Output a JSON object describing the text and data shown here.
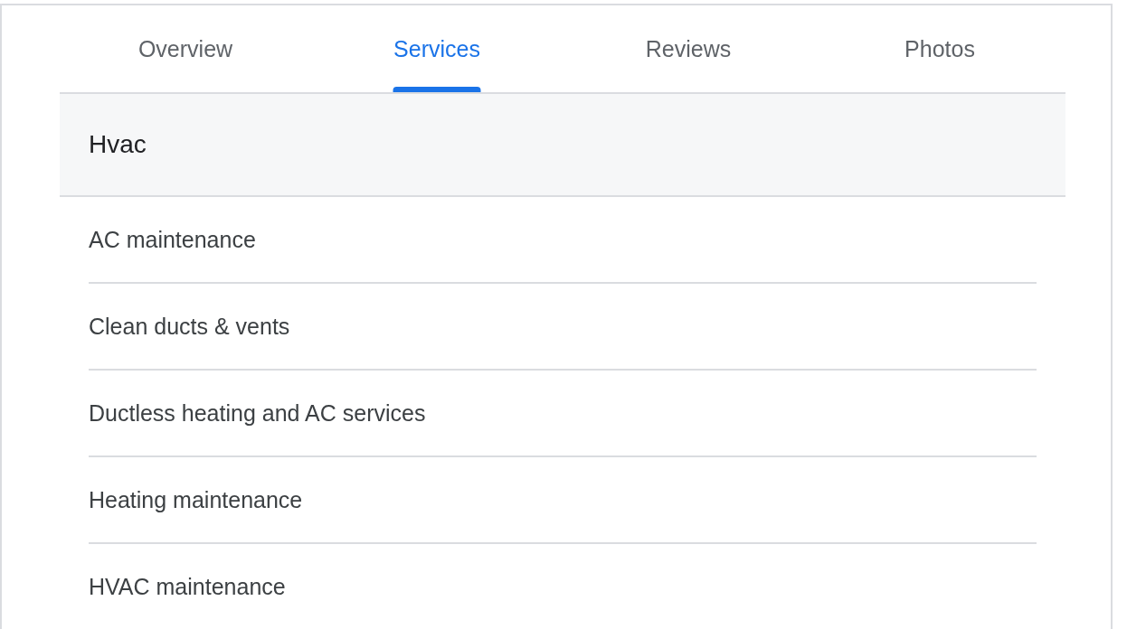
{
  "tabs": [
    {
      "label": "Overview",
      "selected": false
    },
    {
      "label": "Services",
      "selected": true
    },
    {
      "label": "Reviews",
      "selected": false
    },
    {
      "label": "Photos",
      "selected": false
    }
  ],
  "category": {
    "title": "Hvac"
  },
  "services": [
    {
      "name": "AC maintenance"
    },
    {
      "name": "Clean ducts & vents"
    },
    {
      "name": "Ductless heating and AC services"
    },
    {
      "name": "Heating maintenance"
    },
    {
      "name": "HVAC maintenance"
    }
  ]
}
